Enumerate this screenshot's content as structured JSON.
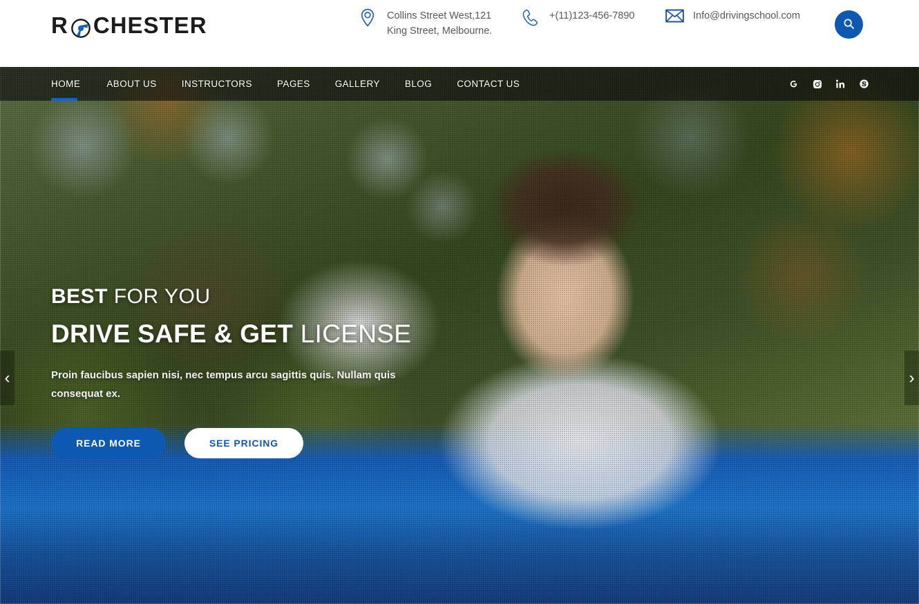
{
  "brand": {
    "name_part1": "R",
    "name_part2": "CHESTER",
    "logo_icon": "steering-wheel-icon",
    "accent_color": "#0d59b2"
  },
  "header": {
    "contacts": [
      {
        "icon": "map-pin-icon",
        "line1": "Collins Street West,121",
        "line2": "King Street, Melbourne."
      },
      {
        "icon": "phone-icon",
        "line1": "+(11)123-456-7890",
        "line2": ""
      },
      {
        "icon": "envelope-icon",
        "line1": "Info@drivingschool.com",
        "line2": ""
      }
    ],
    "search_icon": "search-icon"
  },
  "nav": {
    "items": [
      {
        "label": "HOME",
        "active": true
      },
      {
        "label": "ABOUT US",
        "active": false
      },
      {
        "label": "INSTRUCTORS",
        "active": false
      },
      {
        "label": "PAGES",
        "active": false
      },
      {
        "label": "GALLERY",
        "active": false
      },
      {
        "label": "BLOG",
        "active": false
      },
      {
        "label": "CONTACT US",
        "active": false
      }
    ],
    "social": [
      {
        "name": "google-plus-icon",
        "glyph": "G"
      },
      {
        "name": "instagram-icon",
        "glyph": ""
      },
      {
        "name": "linkedin-icon",
        "glyph": "in"
      },
      {
        "name": "skype-icon",
        "glyph": "S"
      }
    ],
    "active_indicator_color": "#1565c0"
  },
  "hero": {
    "kicker_bold": "BEST",
    "kicker_light": "FOR YOU",
    "headline_bold": "DRIVE SAFE & GET",
    "headline_light": "LICENSE",
    "description": "Proin faucibus sapien nisi, nec tempus arcu sagittis quis. Nullam quis consequat ex.",
    "primary_button": "READ MORE",
    "secondary_button": "SEE PRICING",
    "prev_arrow": "‹",
    "next_arrow": "›"
  }
}
